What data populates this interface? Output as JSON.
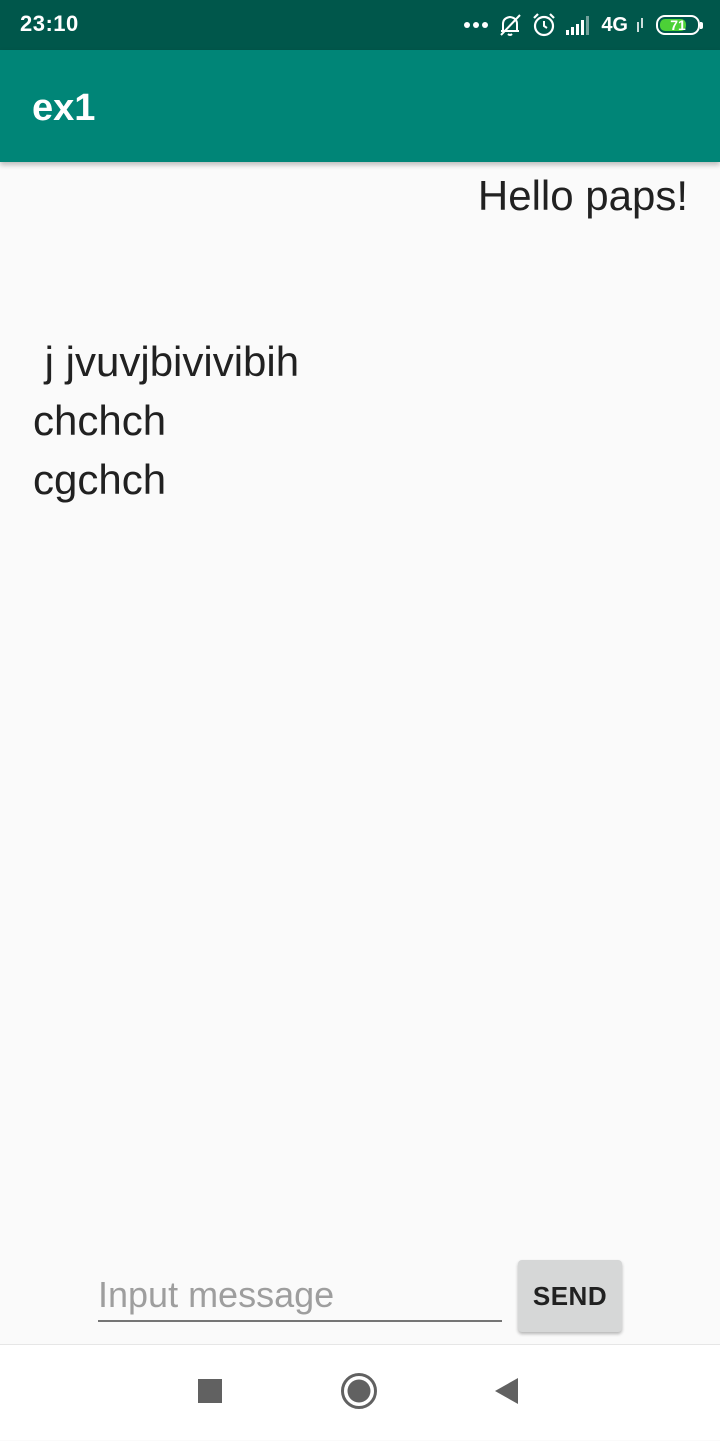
{
  "status_bar": {
    "time": "23:10",
    "network": "4G",
    "battery_level": "71",
    "battery_fraction": 0.71,
    "icons": [
      "more-dots-icon",
      "bell-off-icon",
      "alarm-icon",
      "signal-icon",
      "battery-icon"
    ]
  },
  "app_bar": {
    "title": "ex1"
  },
  "messages": {
    "incoming": "Hello paps!",
    "outgoing": " j jvuvjbivivibih\nchchch\ncgchch"
  },
  "composer": {
    "placeholder": "Input message",
    "value": "",
    "send_label": "SEND"
  },
  "nav_bar": {
    "icons": [
      "recents-square-icon",
      "home-circle-icon",
      "back-triangle-icon"
    ]
  },
  "colors": {
    "status_bar": "#00574b",
    "app_bar": "#008577",
    "background": "#fafafa",
    "button": "#d6d7d7",
    "battery_fill": "#4cd137"
  }
}
